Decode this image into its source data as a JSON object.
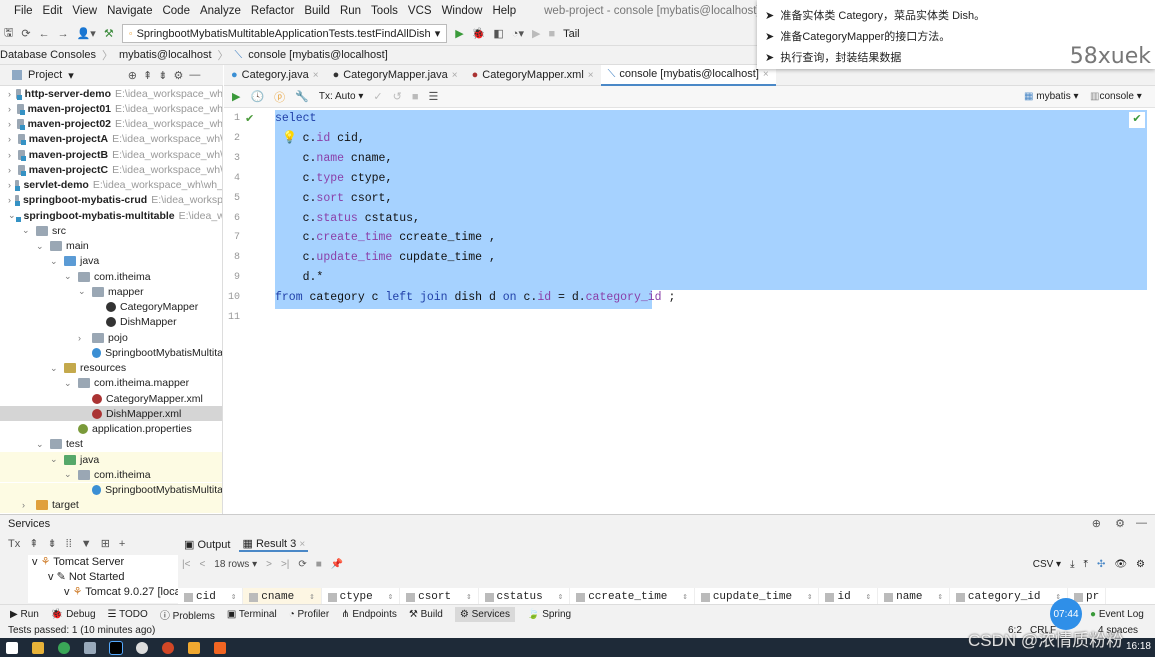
{
  "menu": {
    "items": [
      "File",
      "Edit",
      "View",
      "Navigate",
      "Code",
      "Analyze",
      "Refactor",
      "Build",
      "Run",
      "Tools",
      "VCS",
      "Window",
      "Help"
    ],
    "window_title": "web-project - console [mybatis@localhost]"
  },
  "toolbar": {
    "run_config": "SpringbootMybatisMultitableApplicationTests.testFindAllDish",
    "tail": "Tail"
  },
  "breadcrumb": [
    "Database Consoles",
    "mybatis@localhost",
    "console [mybatis@localhost]"
  ],
  "project": {
    "title": "Project",
    "tree": [
      {
        "label": "http-server-demo",
        "path": "E:\\idea_workspace_wh",
        "d": 0,
        "t": "mod",
        "b": true,
        "a": ">"
      },
      {
        "label": "maven-project01",
        "path": "E:\\idea_workspace_wh",
        "d": 0,
        "t": "mod",
        "b": true,
        "a": ">"
      },
      {
        "label": "maven-project02",
        "path": "E:\\idea_workspace_wh",
        "d": 0,
        "t": "mod",
        "b": true,
        "a": ">"
      },
      {
        "label": "maven-projectA",
        "path": "E:\\idea_workspace_wh\\",
        "d": 0,
        "t": "mod",
        "b": true,
        "a": ">"
      },
      {
        "label": "maven-projectB",
        "path": "E:\\idea_workspace_wh\\",
        "d": 0,
        "t": "mod",
        "b": true,
        "a": ">"
      },
      {
        "label": "maven-projectC",
        "path": "E:\\idea_workspace_wh\\",
        "d": 0,
        "t": "mod",
        "b": true,
        "a": ">"
      },
      {
        "label": "servlet-demo",
        "path": "E:\\idea_workspace_wh\\wh_",
        "d": 0,
        "t": "mod",
        "b": true,
        "a": ">"
      },
      {
        "label": "springboot-mybatis-crud",
        "path": "E:\\idea_worksp",
        "d": 0,
        "t": "mod",
        "b": true,
        "a": ">"
      },
      {
        "label": "springboot-mybatis-multitable",
        "path": "E:\\idea_w",
        "d": 0,
        "t": "mod",
        "b": true,
        "a": "v"
      },
      {
        "label": "src",
        "path": "",
        "d": 1,
        "t": "",
        "a": "v"
      },
      {
        "label": "main",
        "path": "",
        "d": 2,
        "t": "",
        "a": "v"
      },
      {
        "label": "java",
        "path": "",
        "d": 3,
        "t": "src",
        "a": "v"
      },
      {
        "label": "com.itheima",
        "path": "",
        "d": 4,
        "t": "",
        "a": "v"
      },
      {
        "label": "mapper",
        "path": "",
        "d": 5,
        "t": "",
        "a": "v"
      },
      {
        "label": "CategoryMapper",
        "path": "",
        "d": 6,
        "t": "mapper",
        "a": ""
      },
      {
        "label": "DishMapper",
        "path": "",
        "d": 6,
        "t": "mapper",
        "a": ""
      },
      {
        "label": "pojo",
        "path": "",
        "d": 5,
        "t": "",
        "a": ">"
      },
      {
        "label": "SpringbootMybatisMultita",
        "path": "",
        "d": 5,
        "t": "class",
        "a": ""
      },
      {
        "label": "resources",
        "path": "",
        "d": 3,
        "t": "res",
        "a": "v"
      },
      {
        "label": "com.itheima.mapper",
        "path": "",
        "d": 4,
        "t": "",
        "a": "v"
      },
      {
        "label": "CategoryMapper.xml",
        "path": "",
        "d": 5,
        "t": "xml",
        "a": ""
      },
      {
        "label": "DishMapper.xml",
        "path": "",
        "d": 5,
        "t": "xml",
        "a": "",
        "sel": true
      },
      {
        "label": "application.properties",
        "path": "",
        "d": 4,
        "t": "prop",
        "a": ""
      },
      {
        "label": "test",
        "path": "",
        "d": 2,
        "t": "",
        "a": "v"
      },
      {
        "label": "java",
        "path": "",
        "d": 3,
        "t": "test",
        "a": "v",
        "hl": true
      },
      {
        "label": "com.itheima",
        "path": "",
        "d": 4,
        "t": "",
        "a": "v",
        "hl": true
      },
      {
        "label": "SpringbootMybatisMultita",
        "path": "",
        "d": 5,
        "t": "class",
        "a": "",
        "hl": true
      },
      {
        "label": "target",
        "path": "",
        "d": 1,
        "t": "tgt",
        "a": ">",
        "hl": true
      }
    ]
  },
  "tabs": [
    {
      "label": "Category.java",
      "icon": "class-icon"
    },
    {
      "label": "CategoryMapper.java",
      "icon": "mapper-icon"
    },
    {
      "label": "CategoryMapper.xml",
      "icon": "xml-icon"
    },
    {
      "label": "console [mybatis@localhost]",
      "icon": "console-icon",
      "active": true
    }
  ],
  "editor_toolbar": {
    "tx": "Tx: Auto",
    "datasource": "mybatis",
    "session": "console"
  },
  "code": {
    "lines": [
      [
        [
          "kw",
          "select"
        ]
      ],
      [
        [
          "",
          "    c."
        ],
        [
          "fd",
          "id"
        ],
        [
          "",
          " cid,"
        ]
      ],
      [
        [
          "",
          "    c."
        ],
        [
          "fd",
          "name"
        ],
        [
          "",
          " cname,"
        ]
      ],
      [
        [
          "",
          "    c."
        ],
        [
          "fd",
          "type"
        ],
        [
          "",
          " ctype,"
        ]
      ],
      [
        [
          "",
          "    c."
        ],
        [
          "fd",
          "sort"
        ],
        [
          "",
          " csort,"
        ]
      ],
      [
        [
          "",
          "    c."
        ],
        [
          "fd",
          "status"
        ],
        [
          "",
          " cstatus,"
        ]
      ],
      [
        [
          "",
          "    c."
        ],
        [
          "fd",
          "create_time"
        ],
        [
          "",
          " ccreate_time ,"
        ]
      ],
      [
        [
          "",
          "    c."
        ],
        [
          "fd",
          "update_time"
        ],
        [
          "",
          " cupdate_time ,"
        ]
      ],
      [
        [
          "",
          "    d.*"
        ]
      ],
      [
        [
          "kw",
          "from"
        ],
        [
          "",
          " category c "
        ],
        [
          "kw",
          "left join"
        ],
        [
          "",
          " dish d "
        ],
        [
          "kw",
          "on"
        ],
        [
          "",
          " c."
        ],
        [
          "fd",
          "id"
        ],
        [
          "",
          " = d."
        ],
        [
          "fd",
          "category_id"
        ],
        [
          "",
          " ;"
        ]
      ],
      []
    ]
  },
  "overlay": {
    "bullets": [
      "准备实体类 Category，菜品实体类 Dish。",
      "准备CategoryMapper的接口方法。",
      "执行查询，封装结果数据"
    ],
    "watermark": "58xuek"
  },
  "services": {
    "title": "Services",
    "tree": [
      "Tomcat Server",
      "Not Started",
      "Tomcat 9.0.27 [loca"
    ],
    "tabs": [
      "Output",
      "Result 3"
    ],
    "rows": "18 rows",
    "csv": "CSV",
    "columns": [
      "cid",
      "cname",
      "ctype",
      "csort",
      "cstatus",
      "ccreate_time",
      "cupdate_time",
      "id",
      "name",
      "category_id",
      "pr"
    ]
  },
  "bottom_tools": [
    "Run",
    "Debug",
    "TODO",
    "Problems",
    "Terminal",
    "Profiler",
    "Endpoints",
    "Build",
    "Services",
    "Spring",
    "Event Log"
  ],
  "status": {
    "text": "Tests passed: 1 (10 minutes ago)",
    "pos": "6:2",
    "enc": "CRLF",
    "indent": "4 spaces"
  },
  "clock": "07:44",
  "taskbar": {
    "time": "16:18",
    "csdn": "CSDN @浓情质粉粉"
  },
  "colors": {
    "selection": "#a6d2ff",
    "keyword": "#1f3fa8",
    "field": "#8a3fa8",
    "accent": "#4a88c7"
  }
}
